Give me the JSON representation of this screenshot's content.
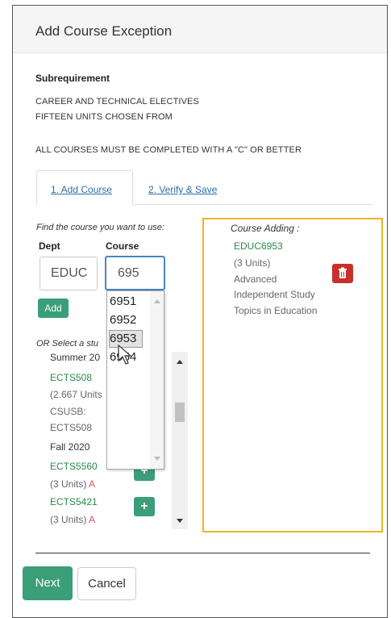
{
  "modal": {
    "title": "Add Course Exception"
  },
  "subrequirement": {
    "heading": "Subrequirement",
    "line1": "CAREER AND TECHNICAL ELECTIVES",
    "line2": "FIFTEEN UNITS CHOSEN FROM",
    "line3": "ALL COURSES MUST BE COMPLETED WITH A \"C\" OR BETTER"
  },
  "tabs": [
    {
      "label": "1. Add Course",
      "active": true
    },
    {
      "label": "2. Verify & Save",
      "active": false
    }
  ],
  "find": {
    "label": "Find the course you want to use:",
    "dept_label": "Dept",
    "course_label": "Course",
    "dept_value": "EDUC",
    "course_value": "695",
    "add_label": "Add"
  },
  "dropdown": {
    "options": [
      "6951",
      "6952",
      "6953",
      "6954"
    ],
    "selected": "6953"
  },
  "student_list": {
    "label": "OR Select a stu",
    "items": [
      {
        "term": "Summer 20"
      },
      {
        "course": "ECTS508",
        "units": "(2.667 Units",
        "note1": "CSUSB:",
        "note2": "ECTS508"
      },
      {
        "term": "Fall 2020"
      },
      {
        "course": "ECTS5560",
        "units": "(3 Units)",
        "grade": "A"
      },
      {
        "course": "ECTS5421",
        "units": "(3 Units)",
        "grade": "A"
      }
    ]
  },
  "course_adding": {
    "title": "Course Adding :",
    "code": "EDUC6953",
    "units": "(3 Units)",
    "name_line1": "Advanced",
    "name_line2": "Independent Study",
    "name_line3": "Topics in Education"
  },
  "footer": {
    "next_label": "Next",
    "cancel_label": "Cancel"
  },
  "colors": {
    "accent_green": "#3a9e78",
    "panel_border": "#f0b429",
    "delete_red": "#c9302c",
    "link_blue": "#2a6ea8"
  }
}
